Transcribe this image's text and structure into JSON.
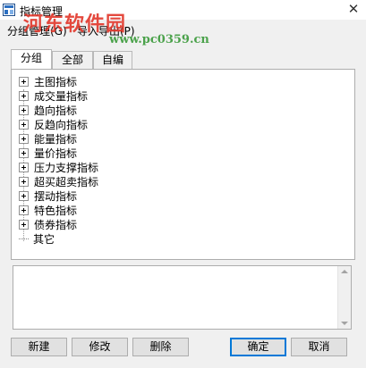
{
  "window": {
    "title": "指标管理",
    "close_glyph": "✕"
  },
  "watermark": {
    "text": "河东软件园",
    "url": "www.pc0359.cn"
  },
  "menu": [
    {
      "label": "分组管理(G)"
    },
    {
      "label": "导入导出(P)"
    }
  ],
  "tabs": [
    {
      "label": "分组",
      "active": true
    },
    {
      "label": "全部",
      "active": false
    },
    {
      "label": "自编",
      "active": false
    }
  ],
  "tree": {
    "items": [
      {
        "label": "主图指标",
        "expandable": true
      },
      {
        "label": "成交量指标",
        "expandable": true
      },
      {
        "label": "趋向指标",
        "expandable": true
      },
      {
        "label": "反趋向指标",
        "expandable": true
      },
      {
        "label": "能量指标",
        "expandable": true
      },
      {
        "label": "量价指标",
        "expandable": true
      },
      {
        "label": "压力支撑指标",
        "expandable": true
      },
      {
        "label": "超买超卖指标",
        "expandable": true
      },
      {
        "label": "摆动指标",
        "expandable": true
      },
      {
        "label": "特色指标",
        "expandable": true
      },
      {
        "label": "债券指标",
        "expandable": true
      },
      {
        "label": "其它",
        "expandable": false
      }
    ]
  },
  "buttons": {
    "new": "新建",
    "modify": "修改",
    "delete": "删除",
    "ok": "确定",
    "cancel": "取消"
  },
  "colors": {
    "accent": "#0078d7",
    "watermark_red": "#e2362a",
    "watermark_green": "#3a9a3a"
  }
}
